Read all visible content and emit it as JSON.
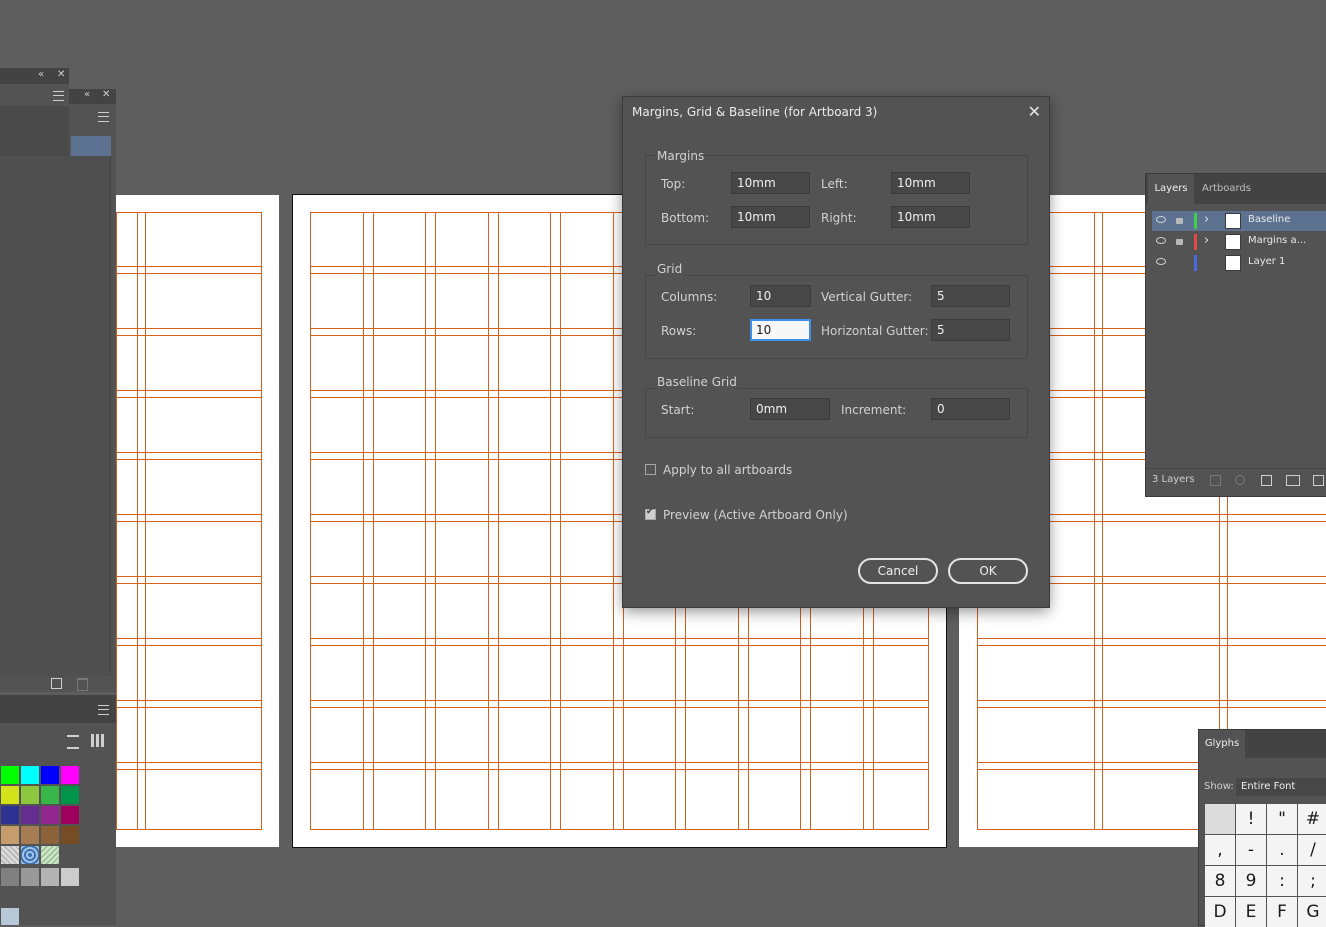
{
  "dialog": {
    "title": "Margins, Grid & Baseline (for Artboard 3)",
    "close_glyph": "✕",
    "margins": {
      "group_label": "Margins",
      "top_label": "Top:",
      "top_value": "10mm",
      "left_label": "Left:",
      "left_value": "10mm",
      "bottom_label": "Bottom:",
      "bottom_value": "10mm",
      "right_label": "Right:",
      "right_value": "10mm"
    },
    "grid": {
      "group_label": "Grid",
      "columns_label": "Columns:",
      "columns_value": "10",
      "vgutter_label": "Vertical Gutter:",
      "vgutter_value": "5",
      "rows_label": "Rows:",
      "rows_value": "10",
      "hgutter_label": "Horizontal Gutter:",
      "hgutter_value": "5"
    },
    "baseline": {
      "group_label": "Baseline Grid",
      "start_label": "Start:",
      "start_value": "0mm",
      "increment_label": "Increment:",
      "increment_value": "0"
    },
    "apply_all_label": "Apply to all artboards",
    "apply_all_checked": false,
    "preview_label": "Preview (Active Artboard Only)",
    "preview_checked": true,
    "cancel_label": "Cancel",
    "ok_label": "OK"
  },
  "layers_panel": {
    "tabs": [
      "Layers",
      "Artboards"
    ],
    "layers": [
      {
        "name": "Baseline",
        "color": "#3fd04a",
        "selected": true,
        "locked": true,
        "expandable": true
      },
      {
        "name": "Margins a...",
        "color": "#e04a4a",
        "selected": false,
        "locked": true,
        "expandable": true
      },
      {
        "name": "Layer 1",
        "color": "#4a6ae0",
        "selected": false,
        "locked": false,
        "expandable": false
      }
    ],
    "count_label": "3 Layers"
  },
  "glyphs_panel": {
    "title": "Glyphs",
    "show_label": "Show:",
    "show_value": "Entire Font",
    "glyphs": [
      "",
      "!",
      "\"",
      "#",
      ",",
      "-",
      ".",
      "/",
      "8",
      "9",
      ":",
      ";",
      "D",
      "E",
      "F",
      "G"
    ]
  },
  "swatches": {
    "rows": [
      [
        "#00ff00",
        "#00ffff",
        "#0000ff",
        "#ff00ff"
      ],
      [
        "#d4e21b",
        "#8dc63f",
        "#39b54a",
        "#00944a"
      ],
      [
        "#2e3192",
        "#662d91",
        "#92278f",
        "#9e005d"
      ],
      [
        "#c69c6d",
        "#a67c52",
        "#8c6239",
        "#754c24"
      ],
      [
        "pattern-a",
        "pattern-b",
        "pattern-c"
      ],
      [
        "#808080",
        "#999999",
        "#b3b3b3",
        "#cccccc"
      ]
    ]
  },
  "icons": {
    "collapse": "«",
    "close": "✕",
    "eye": "👁",
    "lock": "🔒",
    "expand": "›",
    "list_view": "list-icon",
    "grid_view": "grid-icon",
    "new": "new-icon",
    "trash": "trash-icon"
  },
  "colors": {
    "guide": "#d2601e",
    "accent_focus": "#3d8ee6",
    "panel_bg": "#535353",
    "canvas_bg": "#5e5e5e"
  }
}
